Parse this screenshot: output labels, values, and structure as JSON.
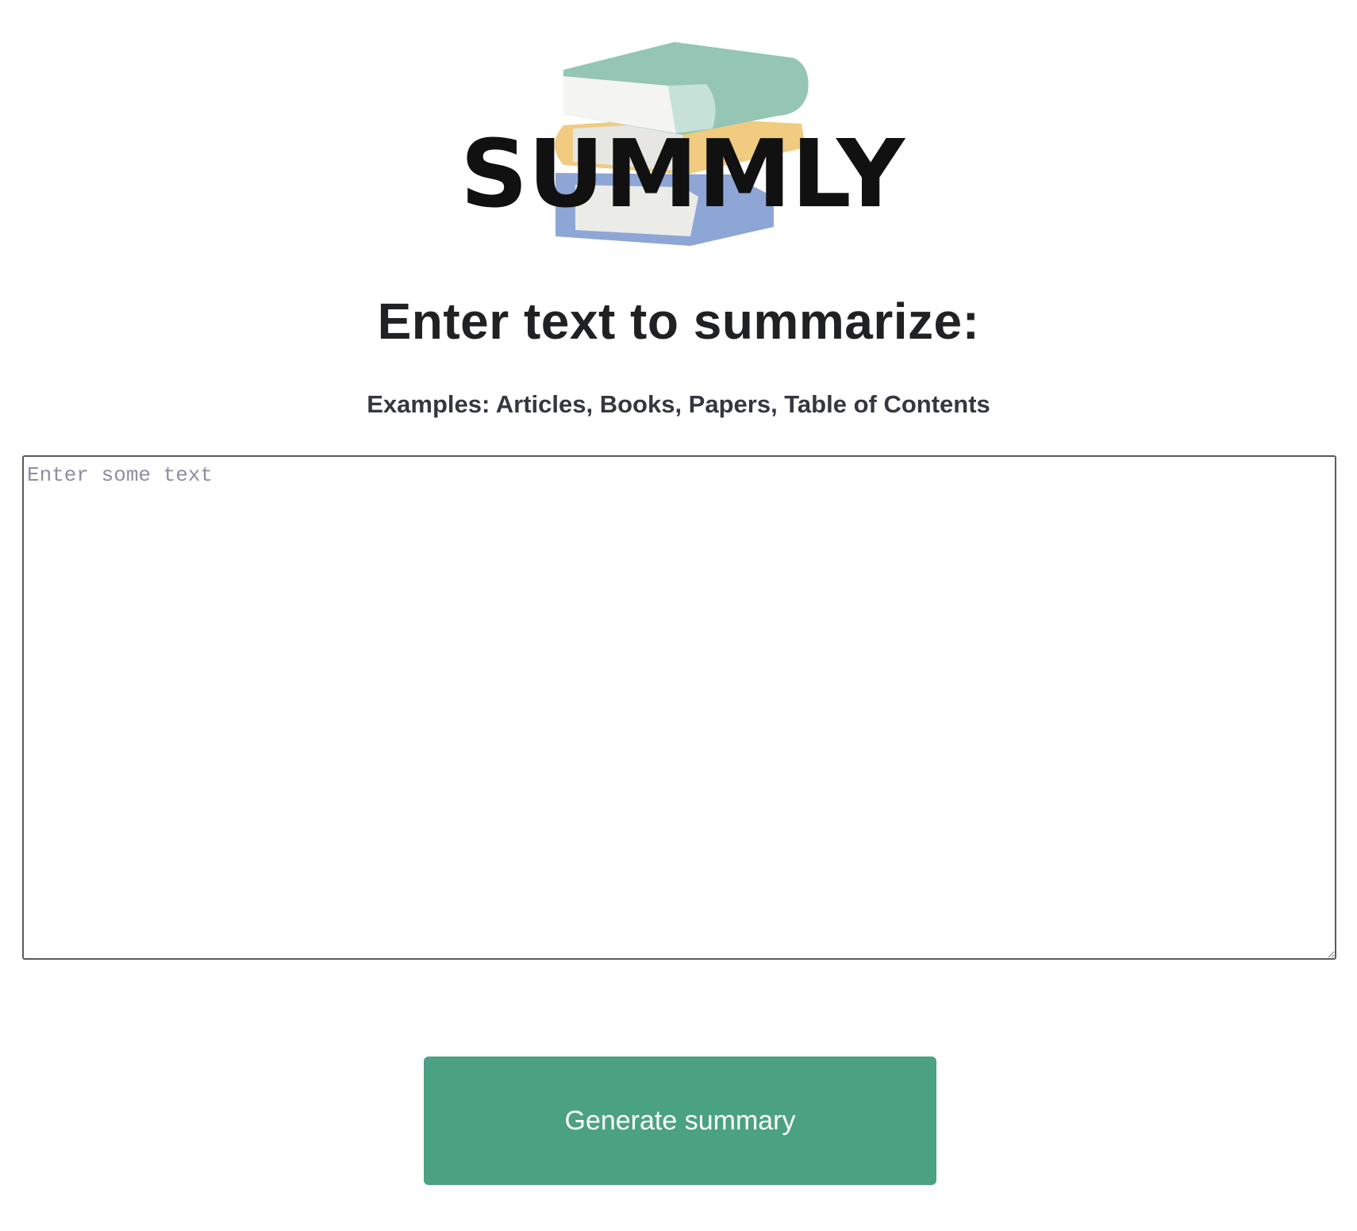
{
  "logo": {
    "wordmark": "SUMMLY",
    "icon": "books-stack-icon"
  },
  "main": {
    "heading": "Enter text to summarize:",
    "examples": "Examples: Articles, Books, Papers, Table of Contents",
    "input": {
      "placeholder": "Enter some text",
      "value": ""
    },
    "generate_button_label": "Generate summary"
  },
  "colors": {
    "accent": "#4ba282",
    "heading": "#202123",
    "book_green": "#94c5b5",
    "book_yellow": "#f0cb80",
    "book_blue": "#8ea6d6"
  }
}
